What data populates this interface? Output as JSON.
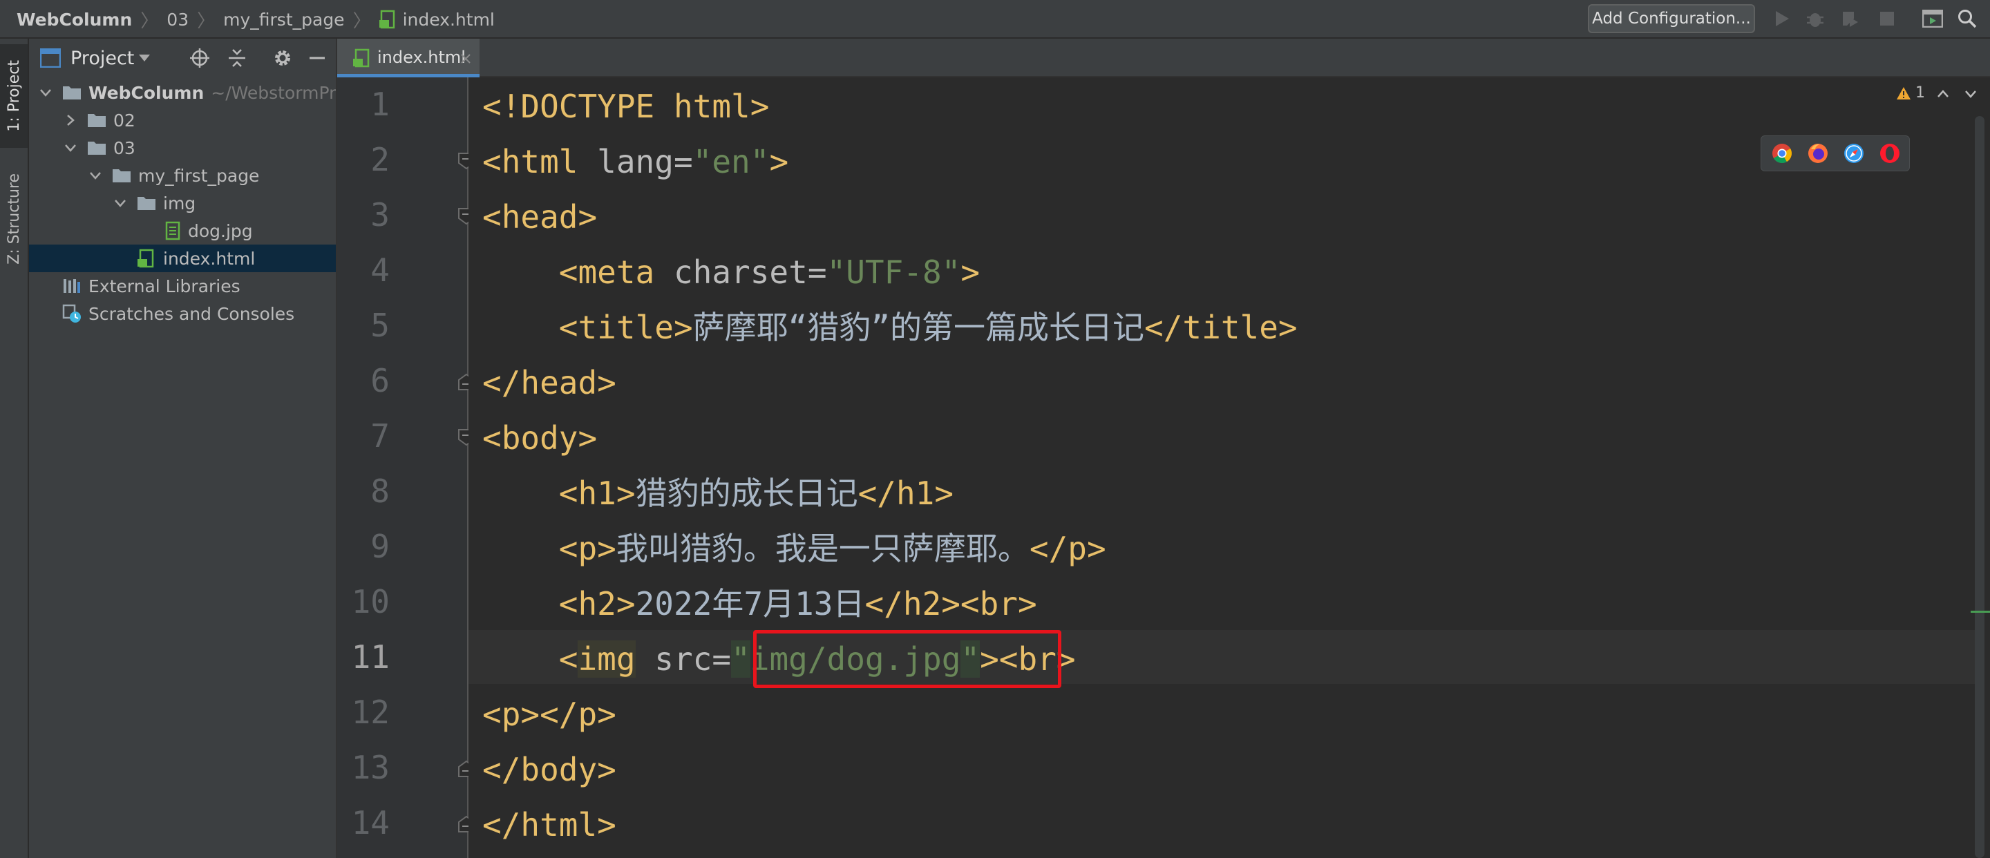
{
  "breadcrumb": [
    "WebColumn",
    "03",
    "my_first_page",
    "index.html"
  ],
  "toolbar": {
    "run_config_label": "Add Configuration..."
  },
  "left_strip": {
    "project_tab": "1: Project",
    "structure_tab": "Z: Structure"
  },
  "project_panel": {
    "title": "Project",
    "root": {
      "name": "WebColumn",
      "path": "~/WebstormPro"
    },
    "folders": [
      "02",
      "03",
      "my_first_page",
      "img"
    ],
    "files": [
      "dog.jpg",
      "index.html"
    ],
    "external_libraries": "External Libraries",
    "scratches": "Scratches and Consoles"
  },
  "editor": {
    "active_tab": "index.html",
    "line_numbers": [
      "1",
      "2",
      "3",
      "4",
      "5",
      "6",
      "7",
      "8",
      "9",
      "10",
      "11",
      "12",
      "13",
      "14"
    ],
    "current_line": "11",
    "warning_count": "1",
    "lines": [
      [
        {
          "t": "tag",
          "v": "<!DOCTYPE html>"
        }
      ],
      [
        {
          "t": "tag",
          "v": "<html "
        },
        {
          "t": "attr",
          "v": "lang="
        },
        {
          "t": "str",
          "v": "\"en\""
        },
        {
          "t": "tag",
          "v": ">"
        }
      ],
      [
        {
          "t": "tag",
          "v": "<head>"
        }
      ],
      [
        {
          "t": "txt",
          "v": "    "
        },
        {
          "t": "tag",
          "v": "<meta "
        },
        {
          "t": "attr",
          "v": "charset="
        },
        {
          "t": "str",
          "v": "\"UTF-8\""
        },
        {
          "t": "tag",
          "v": ">"
        }
      ],
      [
        {
          "t": "txt",
          "v": "    "
        },
        {
          "t": "tag",
          "v": "<title>"
        },
        {
          "t": "txt",
          "v": "萨摩耶“猎豹”的第一篇成长日记"
        },
        {
          "t": "tag",
          "v": "</title>"
        }
      ],
      [
        {
          "t": "tag",
          "v": "</head>"
        }
      ],
      [
        {
          "t": "tag",
          "v": "<body>"
        }
      ],
      [
        {
          "t": "txt",
          "v": "    "
        },
        {
          "t": "tag",
          "v": "<h1>"
        },
        {
          "t": "txt",
          "v": "猎豹的成长日记"
        },
        {
          "t": "tag",
          "v": "</h1>"
        }
      ],
      [
        {
          "t": "txt",
          "v": "    "
        },
        {
          "t": "tag",
          "v": "<p>"
        },
        {
          "t": "txt",
          "v": "我叫猎豹。我是一只萨摩耶。"
        },
        {
          "t": "tag",
          "v": "</p>"
        }
      ],
      [
        {
          "t": "txt",
          "v": "    "
        },
        {
          "t": "tag",
          "v": "<h2>"
        },
        {
          "t": "txt",
          "v": "2022年7月13日"
        },
        {
          "t": "tag",
          "v": "</h2><br>"
        }
      ],
      [
        {
          "t": "txt",
          "v": "    "
        },
        {
          "t": "tag",
          "v": "<"
        },
        {
          "t": "tag hl-img",
          "v": "img"
        },
        {
          "t": "attr",
          "v": " src="
        },
        {
          "t": "str hl-q",
          "v": "\""
        },
        {
          "t": "str",
          "v": "img/dog.jpg"
        },
        {
          "t": "str hl-q",
          "v": "\""
        },
        {
          "t": "tag",
          "v": "><br>"
        }
      ],
      [
        {
          "t": "tag",
          "v": "<p></p>"
        }
      ],
      [
        {
          "t": "tag",
          "v": "</body>"
        }
      ],
      [
        {
          "t": "tag",
          "v": "</html>"
        }
      ]
    ]
  },
  "colors": {
    "tag": "#e8bf6a",
    "attribute": "#bababa",
    "string": "#6a8759",
    "text": "#a9b7c6",
    "highlight_box": "#e8141c",
    "selection": "#0d293e"
  }
}
